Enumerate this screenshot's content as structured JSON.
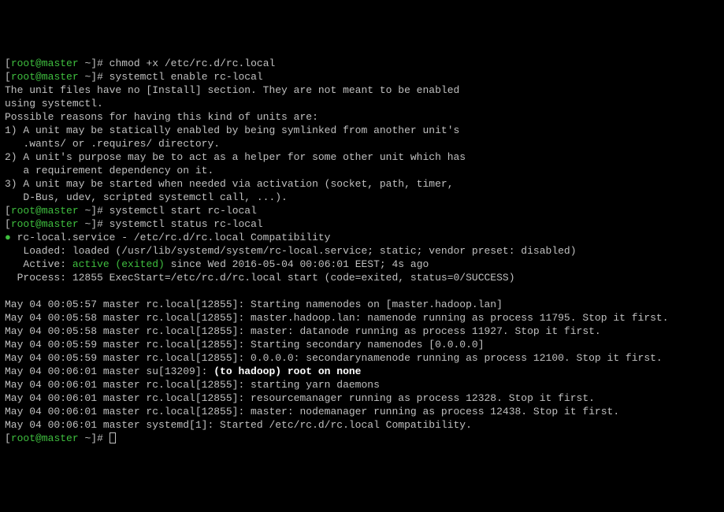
{
  "prompt": {
    "open": "[",
    "user": "root",
    "at": "@",
    "host": "master",
    "path": " ~",
    "close": "]# "
  },
  "commands": {
    "chmod": "chmod +x /etc/rc.d/rc.local",
    "enable": "systemctl enable rc-local",
    "start": "systemctl start rc-local",
    "status": "systemctl status rc-local"
  },
  "enable_output": {
    "l1": "The unit files have no [Install] section. They are not meant to be enabled",
    "l2": "using systemctl.",
    "l3": "Possible reasons for having this kind of units are:",
    "l4": "1) A unit may be statically enabled by being symlinked from another unit's",
    "l5": "   .wants/ or .requires/ directory.",
    "l6": "2) A unit's purpose may be to act as a helper for some other unit which has",
    "l7": "   a requirement dependency on it.",
    "l8": "3) A unit may be started when needed via activation (socket, path, timer,",
    "l9": "   D-Bus, udev, scripted systemctl call, ...)."
  },
  "status_output": {
    "bullet": "●",
    "title": " rc-local.service - /etc/rc.d/rc.local Compatibility",
    "loaded": "   Loaded: loaded (/usr/lib/systemd/system/rc-local.service; static; vendor preset: disabled)",
    "active_prefix": "   Active: ",
    "active_val": "active (exited)",
    "active_suffix": " since Wed 2016-05-04 00:06:01 EEST; 4s ago",
    "process": "  Process: 12855 ExecStart=/etc/rc.d/rc.local start (code=exited, status=0/SUCCESS)"
  },
  "logs": {
    "l01": "May 04 00:05:57 master rc.local[12855]: Starting namenodes on [master.hadoop.lan]",
    "l02": "May 04 00:05:58 master rc.local[12855]: master.hadoop.lan: namenode running as process 11795. Stop it first.",
    "l03": "May 04 00:05:58 master rc.local[12855]: master: datanode running as process 11927. Stop it first.",
    "l04": "May 04 00:05:59 master rc.local[12855]: Starting secondary namenodes [0.0.0.0]",
    "l05": "May 04 00:05:59 master rc.local[12855]: 0.0.0.0: secondarynamenode running as process 12100. Stop it first.",
    "l06_prefix": "May 04 00:06:01 master su[13209]: ",
    "l06_bold": "(to hadoop) root on none",
    "l07": "May 04 00:06:01 master rc.local[12855]: starting yarn daemons",
    "l08": "May 04 00:06:01 master rc.local[12855]: resourcemanager running as process 12328. Stop it first.",
    "l09": "May 04 00:06:01 master rc.local[12855]: master: nodemanager running as process 12438. Stop it first.",
    "l10": "May 04 00:06:01 master systemd[1]: Started /etc/rc.d/rc.local Compatibility."
  }
}
